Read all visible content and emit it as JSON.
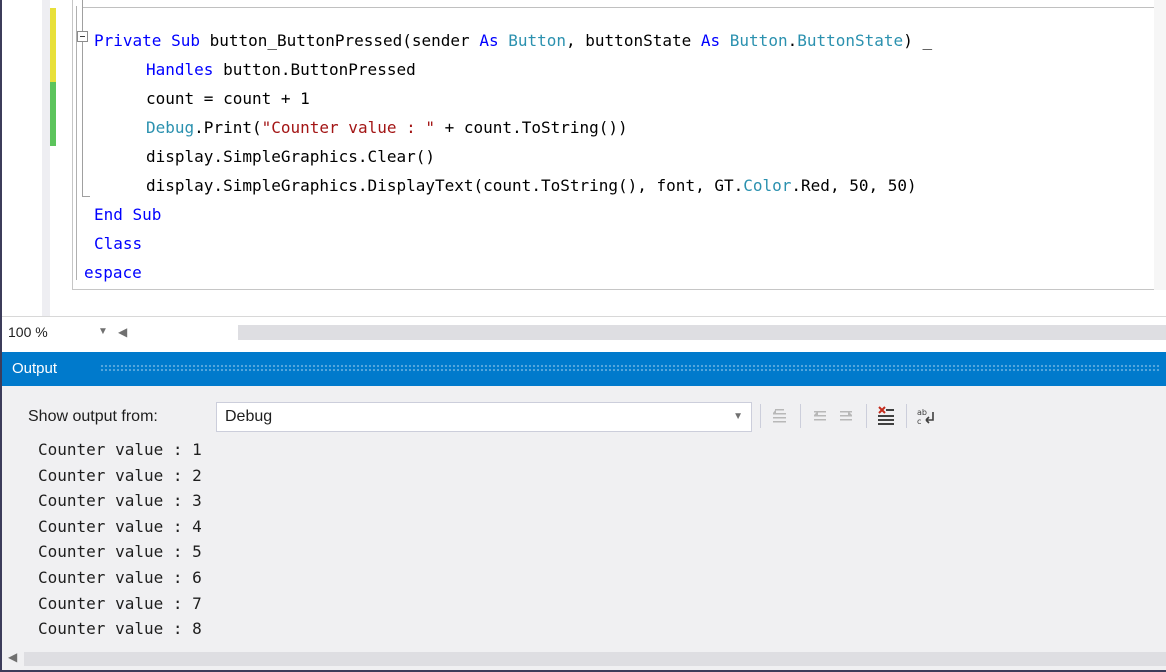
{
  "editor": {
    "lines": [
      {
        "parts": [
          {
            "t": "Private Sub ",
            "c": "kw"
          },
          {
            "t": "button_ButtonPressed(sender ",
            "c": ""
          },
          {
            "t": "As ",
            "c": "kw"
          },
          {
            "t": "Button",
            "c": "ty"
          },
          {
            "t": ", buttonState ",
            "c": ""
          },
          {
            "t": "As ",
            "c": "kw"
          },
          {
            "t": "Button",
            "c": "ty"
          },
          {
            "t": ".",
            "c": ""
          },
          {
            "t": "ButtonState",
            "c": "ty"
          },
          {
            "t": ") _",
            "c": ""
          }
        ]
      },
      {
        "parts": [
          {
            "t": "Handles ",
            "c": "kw"
          },
          {
            "t": "button.ButtonPressed",
            "c": ""
          }
        ]
      },
      {
        "parts": [
          {
            "t": "count = count + 1",
            "c": ""
          }
        ]
      },
      {
        "parts": [
          {
            "t": "Debug",
            "c": "ty"
          },
          {
            "t": ".Print(",
            "c": ""
          },
          {
            "t": "\"Counter value : \"",
            "c": "str"
          },
          {
            "t": " + count.ToString())",
            "c": ""
          }
        ]
      },
      {
        "parts": [
          {
            "t": "display.SimpleGraphics.Clear()",
            "c": ""
          }
        ]
      },
      {
        "parts": [
          {
            "t": "display.SimpleGraphics.DisplayText(count.ToString(), font, GT.",
            "c": ""
          },
          {
            "t": "Color",
            "c": "ty"
          },
          {
            "t": ".Red, 50, 50)",
            "c": ""
          }
        ]
      },
      {
        "parts": [
          {
            "t": "End Sub",
            "c": "kw"
          }
        ]
      },
      {
        "parts": [
          {
            "t": "Class",
            "c": "kw"
          }
        ]
      },
      {
        "parts": [
          {
            "t": "espace",
            "c": "kw"
          }
        ]
      }
    ]
  },
  "zoom": {
    "value": "100 %",
    "dropdown_icon": "chevron-down-icon",
    "scroll_left_icon": "arrow-left-icon"
  },
  "output": {
    "title": "Output",
    "show_label": "Show output from:",
    "source": "Debug",
    "toolbar_icons": [
      "go-to-previous-message-icon",
      "go-to-previous-icon",
      "go-to-next-icon",
      "clear-all-icon",
      "toggle-word-wrap-icon"
    ],
    "lines": [
      "Counter value : 1",
      "Counter value : 2",
      "Counter value : 3",
      "Counter value : 4",
      "Counter value : 5",
      "Counter value : 6",
      "Counter value : 7",
      "Counter value : 8"
    ]
  },
  "colors": {
    "keyword": "#0000ff",
    "type": "#2b91af",
    "string": "#a31515",
    "output_header": "#007acc"
  }
}
